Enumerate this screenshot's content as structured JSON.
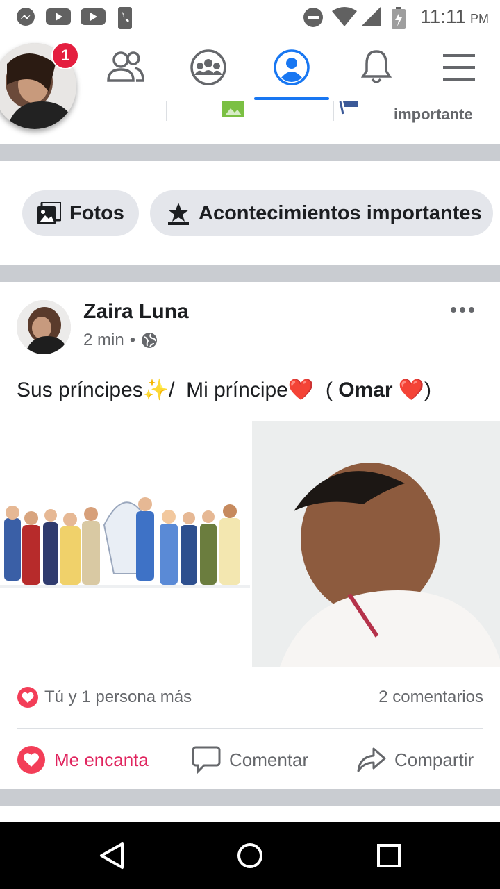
{
  "status_bar": {
    "time": "11:11",
    "ampm": "PM",
    "icons": [
      "messenger-icon",
      "youtube-icon",
      "youtube-icon",
      "phone-icon",
      "dnd-icon",
      "wifi-icon",
      "signal-icon",
      "battery-icon"
    ]
  },
  "top_nav": {
    "notification_count": "1",
    "tabs": [
      "friends-icon",
      "groups-icon",
      "profile-icon",
      "bell-icon",
      "menu-icon"
    ],
    "active_color": "#1877f2"
  },
  "strip": {
    "partial_label": "importante"
  },
  "chips": {
    "photos": "Fotos",
    "life_events": "Acontecimientos importantes"
  },
  "post": {
    "author": "Zaira Luna",
    "time": "2 min",
    "dot": "•",
    "text_part1": "Sus príncipes",
    "sparkles": "✨",
    "text_part2": "/  Mi príncipe",
    "heart": "❤️",
    "paren_open": "  ( ",
    "tagged": "Omar",
    "paren_close": ")",
    "reactions_text": "Tú y 1 persona más",
    "comments_count": "2 comentarios",
    "actions": {
      "love": "Me encanta",
      "comment": "Comentar",
      "share": "Compartir"
    },
    "love_color": "#e0245e"
  }
}
